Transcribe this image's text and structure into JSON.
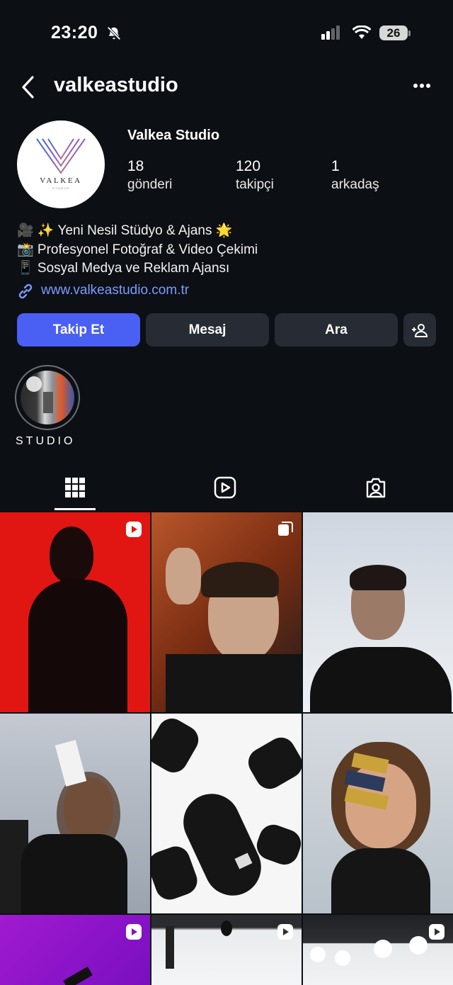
{
  "status_bar": {
    "time": "23:20",
    "battery": "26",
    "icons": [
      "bell-slash-icon",
      "cellular-signal-icon",
      "wifi-icon",
      "battery-icon"
    ]
  },
  "header": {
    "username": "valkeastudio",
    "icons": [
      "chevron-left-icon",
      "more-horizontal-icon"
    ]
  },
  "profile": {
    "avatar_logo_text": "VALKEA",
    "avatar_logo_sub": "STUDIO",
    "display_name": "Valkea Studio",
    "stats": [
      {
        "value": "18",
        "label": "gönderi"
      },
      {
        "value": "120",
        "label": "takipçi"
      },
      {
        "value": "1",
        "label": "arkadaş"
      }
    ],
    "bio": [
      "🎥 ✨ Yeni Nesil Stüdyo & Ajans 🌟",
      "📸 Profesyonel Fotoğraf & Video Çekimi",
      "📱 Sosyal Medya ve Reklam Ajansı"
    ],
    "link": "www.valkeastudio.com.tr"
  },
  "actions": {
    "follow": "Takip Et",
    "message": "Mesaj",
    "call": "Ara"
  },
  "highlights": [
    {
      "label": "STUDIO"
    }
  ],
  "tabs": [
    "grid-icon",
    "reels-icon",
    "tagged-icon"
  ],
  "colors": {
    "background": "#0c0f14",
    "accent": "#4a5ff3",
    "button": "#272b33",
    "link": "#7b9cff"
  },
  "posts": [
    {
      "type": "reel",
      "description_icon": "reel-badge-icon"
    },
    {
      "type": "carousel",
      "description_icon": "carousel-badge-icon"
    },
    {
      "type": "photo"
    },
    {
      "type": "photo"
    },
    {
      "type": "photo"
    },
    {
      "type": "photo"
    },
    {
      "type": "reel",
      "description_icon": "reel-badge-icon"
    },
    {
      "type": "reel",
      "description_icon": "reel-badge-icon"
    },
    {
      "type": "reel",
      "description_icon": "reel-badge-icon"
    }
  ]
}
